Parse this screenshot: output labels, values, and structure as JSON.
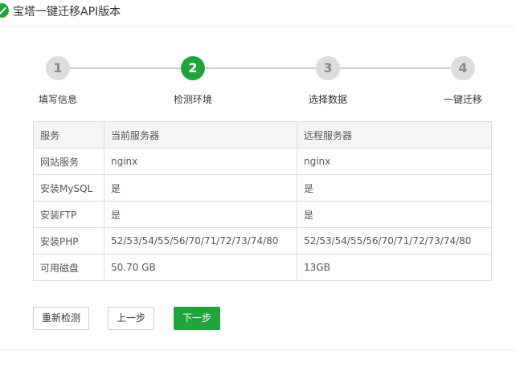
{
  "header": {
    "title": "宝塔一键迁移API版本",
    "icon": "check-circle-icon",
    "accent_color": "#20a53a"
  },
  "steps": [
    {
      "number": "1",
      "label": "填写信息",
      "active": false
    },
    {
      "number": "2",
      "label": "检测环境",
      "active": true
    },
    {
      "number": "3",
      "label": "选择数据",
      "active": false
    },
    {
      "number": "4",
      "label": "一键迁移",
      "active": false
    }
  ],
  "table": {
    "headers": [
      "服务",
      "当前服务器",
      "远程服务器"
    ],
    "rows": [
      [
        "网站服务",
        "nginx",
        "nginx"
      ],
      [
        "安装MySQL",
        "是",
        "是"
      ],
      [
        "安装FTP",
        "是",
        "是"
      ],
      [
        "安装PHP",
        "52/53/54/55/56/70/71/72/73/74/80",
        "52/53/54/55/56/70/71/72/73/74/80"
      ],
      [
        "可用磁盘",
        "50.70 GB",
        "13GB"
      ]
    ]
  },
  "buttons": {
    "recheck": "重新检测",
    "prev": "上一步",
    "next": "下一步"
  }
}
